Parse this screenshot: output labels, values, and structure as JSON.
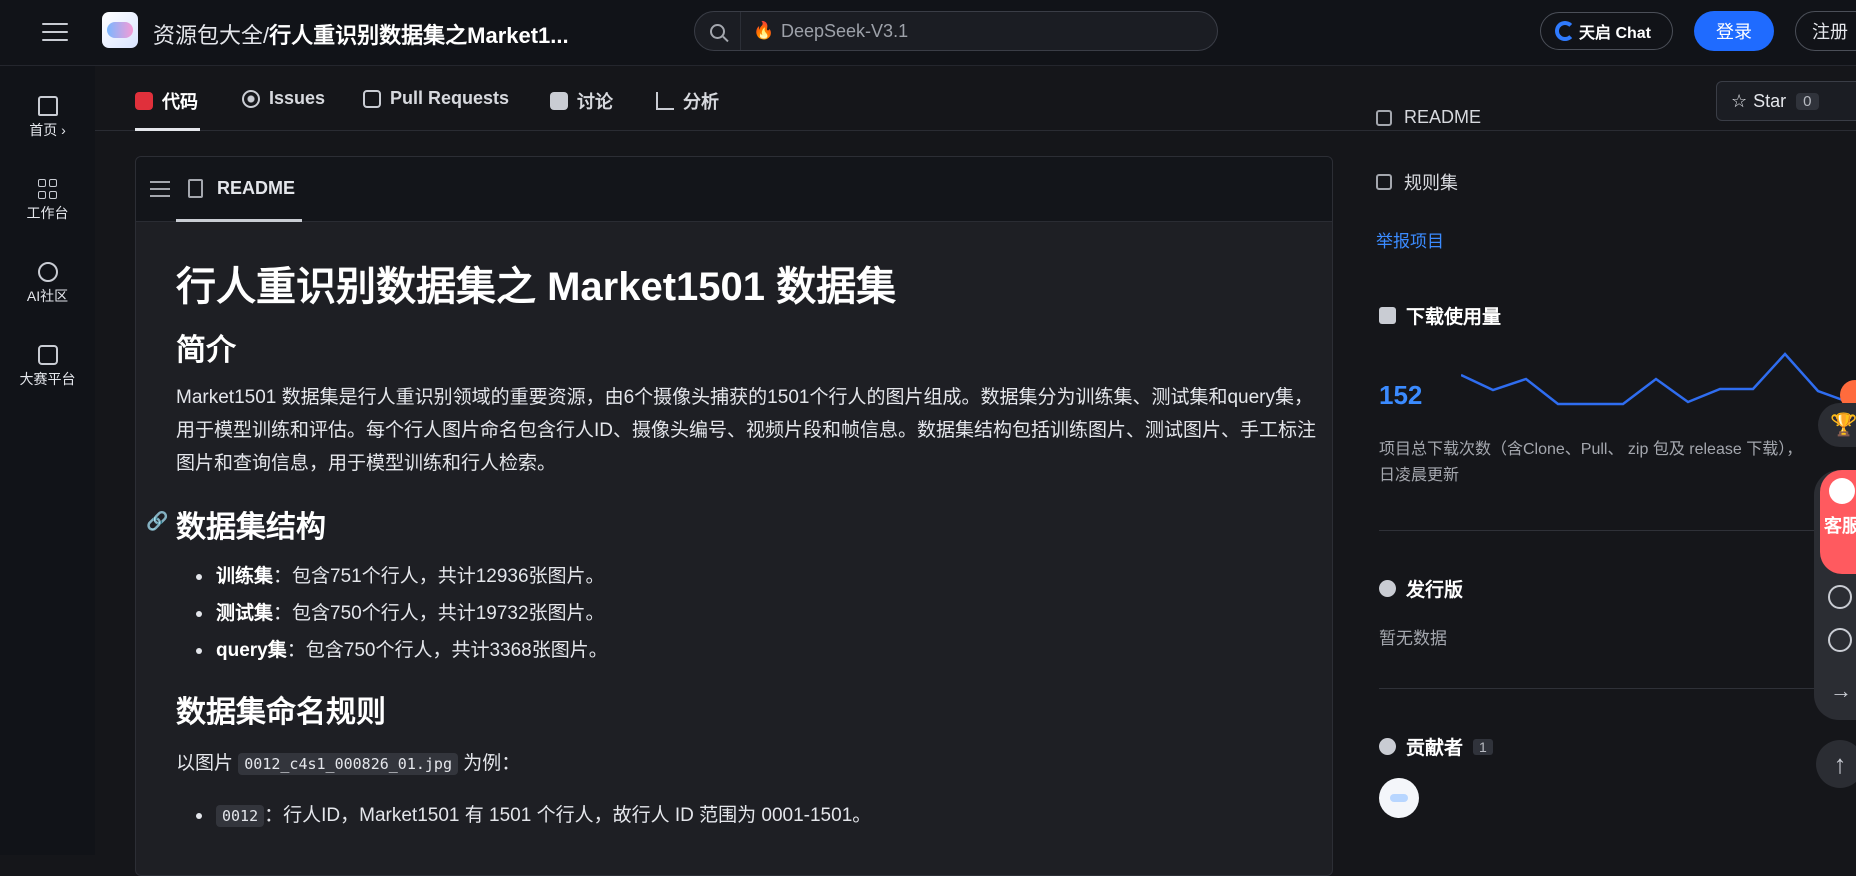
{
  "header": {
    "breadcrumb_parent": "资源包大全",
    "breadcrumb_sep": "/",
    "breadcrumb_current": "行人重识别数据集之Market1...",
    "search_value": "DeepSeek-V3.1",
    "tianqi_label": "天启 Chat",
    "login_label": "登录",
    "register_label": "注册"
  },
  "rail": {
    "items": [
      {
        "label": "首页 ›",
        "icon": "home-icon"
      },
      {
        "label": "工作台",
        "icon": "grid-icon"
      },
      {
        "label": "AI社区",
        "icon": "ai-icon"
      },
      {
        "label": "大赛平台",
        "icon": "trophy-board-icon"
      }
    ]
  },
  "subnav": {
    "tabs": [
      {
        "label": "代码",
        "icon": "code-icon",
        "active": true
      },
      {
        "label": "Issues",
        "icon": "issue-icon"
      },
      {
        "label": "Pull Requests",
        "icon": "pull-request-icon"
      },
      {
        "label": "讨论",
        "icon": "discussion-icon"
      },
      {
        "label": "分析",
        "icon": "chart-icon"
      }
    ],
    "star_label": "Star",
    "star_count": "0"
  },
  "readme": {
    "tab_label": "README",
    "title": "行人重识别数据集之 Market1501 数据集",
    "intro_heading": "简介",
    "intro_text": "Market1501 数据集是行人重识别领域的重要资源，由6个摄像头捕获的1501个行人的图片组成。数据集分为训练集、测试集和query集，用于模型训练和评估。每个行人图片命名包含行人ID、摄像头编号、视频片段和帧信息。数据集结构包括训练图片、测试图片、手工标注图片和查询信息，用于模型训练和行人检索。",
    "structure_heading": "数据集结构",
    "structure_items": [
      {
        "name": "训练集",
        "desc": "：包含751个行人，共计12936张图片。"
      },
      {
        "name": "测试集",
        "desc": "：包含750个行人，共计19732张图片。"
      },
      {
        "name": "query集",
        "desc": "：包含750个行人，共计3368张图片。"
      }
    ],
    "naming_heading": "数据集命名规则",
    "example_prefix": "以图片 ",
    "example_code": "0012_c4s1_000826_01.jpg",
    "example_suffix": " 为例：",
    "naming_items": [
      {
        "code": "0012",
        "desc": "：行人ID，Market1501 有 1501 个行人，故行人 ID 范围为 0001-1501。"
      }
    ]
  },
  "sidebar": {
    "readme_link": "README",
    "rules_link": "规则集",
    "report_link": "举报项目",
    "downloads_title": "下载使用量",
    "downloads_count": "152",
    "downloads_desc": "项目总下载次数（含Clone、Pull、 zip 包及 release 下载），",
    "downloads_desc2": "日凌晨更新",
    "releases_title": "发行版",
    "releases_empty": "暂无数据",
    "contributors_title": "贡献者",
    "contributors_count": "1"
  },
  "floating": {
    "kefu_label": "客服"
  },
  "colors": {
    "accent": "#1f6bff",
    "link": "#3b8bff",
    "code_tab": "#e0303b",
    "kefu": "#ff5a5f"
  }
}
